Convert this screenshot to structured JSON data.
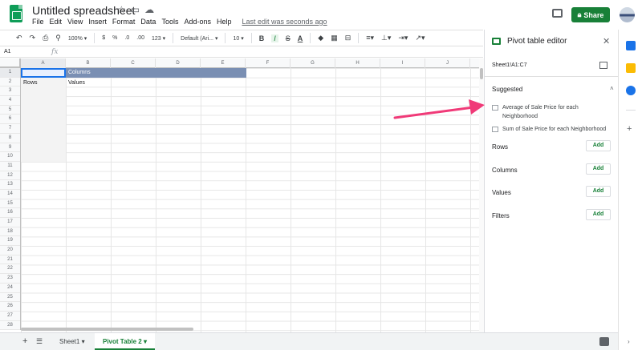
{
  "header": {
    "title": "Untitled spreadsheet",
    "title_icons": [
      "star-icon",
      "folder-icon",
      "cloud-icon"
    ],
    "menu": [
      "File",
      "Edit",
      "View",
      "Insert",
      "Format",
      "Data",
      "Tools",
      "Add-ons",
      "Help"
    ],
    "last_edit": "Last edit was seconds ago",
    "share_label": "Share"
  },
  "toolbar": {
    "zoom": "100%",
    "currency": "$",
    "percent": "%",
    "dec_decrease": ".0",
    "dec_increase": ".00",
    "more_formats": "123",
    "font": "Default (Ari...",
    "font_size": "10",
    "bold": "B",
    "italic": "I",
    "strike": "S",
    "text_color": "A"
  },
  "formula_bar": {
    "cell_ref": "A1",
    "fx": "fx"
  },
  "grid": {
    "columns": [
      "A",
      "B",
      "C",
      "D",
      "E",
      "F",
      "G",
      "H",
      "I",
      "J"
    ],
    "rows": [
      "1",
      "2",
      "3",
      "4",
      "5",
      "6",
      "7",
      "8",
      "9",
      "10",
      "11",
      "12",
      "13",
      "14",
      "15",
      "16",
      "17",
      "18",
      "19",
      "20",
      "21",
      "22",
      "23",
      "24",
      "25",
      "26",
      "27",
      "28"
    ],
    "cells": {
      "b1": "Columns",
      "a2": "Rows",
      "b2": "Values"
    }
  },
  "sheets": {
    "tabs": [
      "Sheet1",
      "Pivot Table 2"
    ],
    "active": "Pivot Table 2"
  },
  "pivot_editor": {
    "title": "Pivot table editor",
    "range": "Sheet1!A1:C7",
    "suggested_title": "Suggested",
    "suggestions": [
      "Average of Sale Price for each Neighborhood",
      "Sum of Sale Price for each Neighborhood"
    ],
    "sections": [
      {
        "label": "Rows",
        "button": "Add"
      },
      {
        "label": "Columns",
        "button": "Add"
      },
      {
        "label": "Values",
        "button": "Add"
      },
      {
        "label": "Filters",
        "button": "Add"
      }
    ]
  },
  "colors": {
    "accent": "#188038",
    "header_band": "#7a8fb3",
    "arrow": "#f03a78"
  }
}
